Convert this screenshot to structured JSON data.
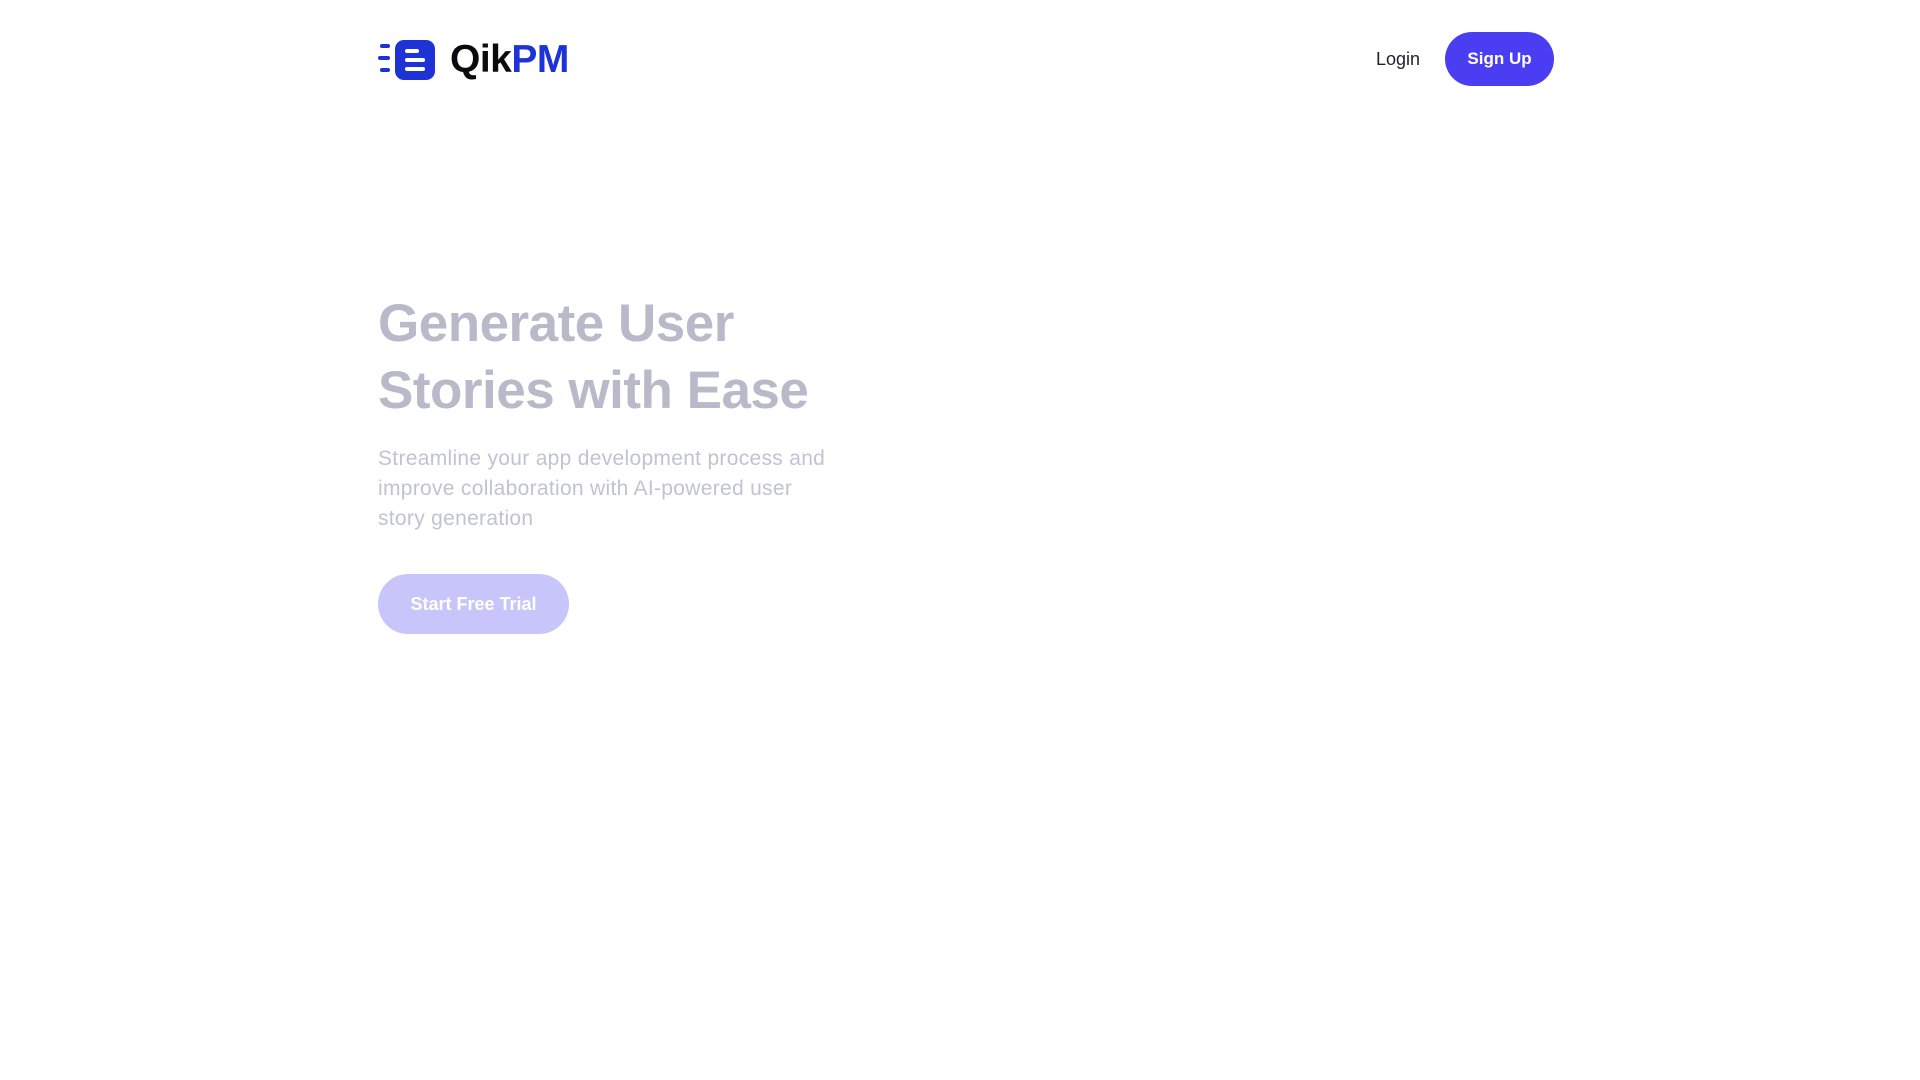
{
  "brand": {
    "name_part1": "Qik",
    "name_part2": "PM",
    "logo_icon": "document-list-icon",
    "color": "#1d33d6"
  },
  "nav": {
    "login_label": "Login",
    "signup_label": "Sign Up",
    "signup_color": "#4b3ef2"
  },
  "hero": {
    "title": "Generate User Stories with Ease",
    "subtitle": "Streamline your app development process and improve collaboration with AI-powered user story generation",
    "cta_label": "Start Free Trial",
    "cta_color": "#c8c5fb"
  }
}
